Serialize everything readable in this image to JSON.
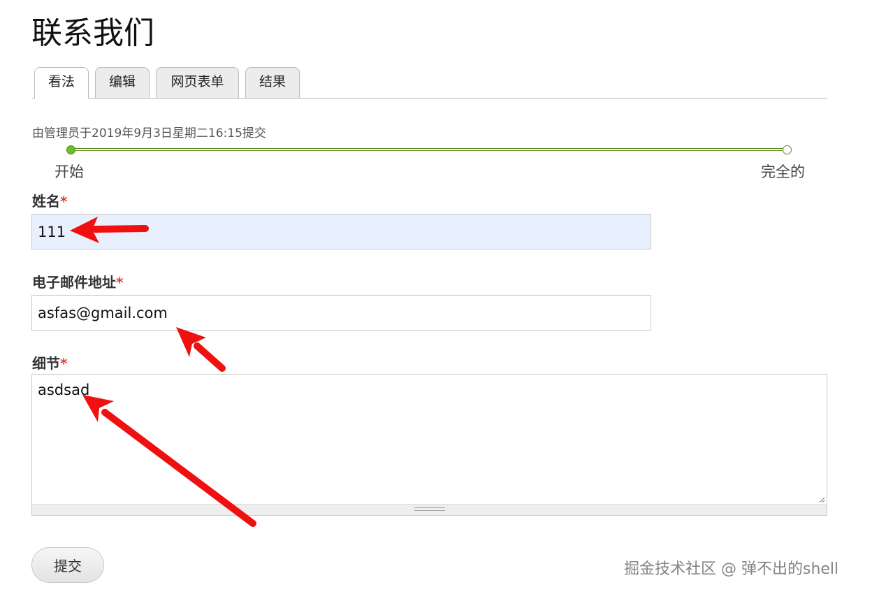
{
  "page": {
    "title": "联系我们"
  },
  "tabs": [
    {
      "label": "看法",
      "active": true
    },
    {
      "label": "编辑",
      "active": false
    },
    {
      "label": "网页表单",
      "active": false
    },
    {
      "label": "结果",
      "active": false
    }
  ],
  "submission": {
    "meta": "由管理员于2019年9月3日星期二16:15提交"
  },
  "progress": {
    "start_label": "开始",
    "end_label": "完全的",
    "fraction": 1.0
  },
  "form": {
    "required_mark": "*",
    "name": {
      "label": "姓名",
      "value": "111"
    },
    "email": {
      "label": "电子邮件地址",
      "value": "asfas@gmail.com"
    },
    "details": {
      "label": "细节",
      "value": "asdsad"
    },
    "submit_label": "提交"
  },
  "watermark": "掘金技术社区 @ 弹不出的shell",
  "colors": {
    "required": "#e0261d",
    "progress": "#5a8a1a",
    "progress_start_dot": "#6bbf2a",
    "autofill_bg": "#e8f0fe",
    "annotation_arrow": "#f01010"
  }
}
